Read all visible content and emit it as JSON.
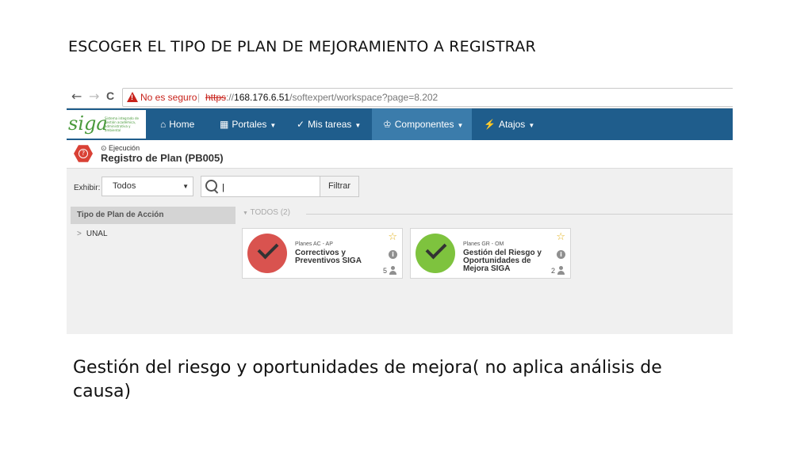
{
  "slide": {
    "title": "ESCOGER EL TIPO DE PLAN DE MEJORAMIENTO A REGISTRAR",
    "caption": "Gestión del riesgo y oportunidades de mejora( no aplica análisis de causa)"
  },
  "browser": {
    "back_icon": "←",
    "forward_icon": "→",
    "reload_icon": "C",
    "security_label": "No es seguro",
    "url_scheme": "https",
    "url_host": "168.176.6.51",
    "url_path": "/softexpert/workspace?page=8.202"
  },
  "app": {
    "logo_text": "siga",
    "logo_subtitle": "Sistema integrado de gestión académica, administrativa y ambiental",
    "nav": [
      {
        "label": "Home",
        "icon": "⌂"
      },
      {
        "label": "Portales",
        "icon": "▦"
      },
      {
        "label": "Mis tareas",
        "icon": "✓"
      },
      {
        "label": "Componentes",
        "icon": "♔"
      },
      {
        "label": "Atajos",
        "icon": "⚡"
      }
    ],
    "active_nav": "Componentes",
    "nav_bg": "#1f5d8c",
    "nav_active_bg": "#3b7cab"
  },
  "header": {
    "status": "Ejecución",
    "title": "Registro de Plan (PB005)"
  },
  "filter": {
    "exhibir_label": "Exhibir:",
    "select_value": "Todos",
    "search_value": "|",
    "filter_button": "Filtrar"
  },
  "sidebar": {
    "header": "Tipo de Plan de Acción",
    "items": [
      {
        "label": "UNAL"
      }
    ]
  },
  "group": {
    "label": "TODOS (2)"
  },
  "cards": [
    {
      "type": "Planes AC - AP",
      "name": "Correctivos y Preventivos SIGA",
      "count": "5",
      "color": "#d9534f"
    },
    {
      "type": "Planes GR - OM",
      "name": "Gestión del Riesgo y Oportunidades de Mejora SIGA",
      "count": "2",
      "color": "#7ec33e"
    }
  ]
}
